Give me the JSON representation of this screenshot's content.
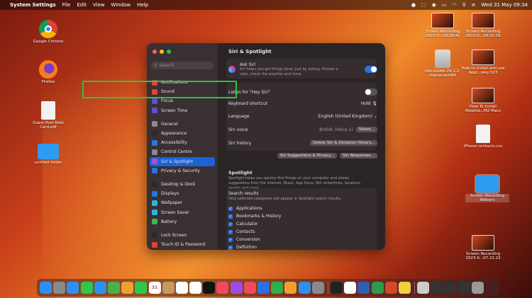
{
  "menubar": {
    "app_name": "System Settings",
    "items": [
      "File",
      "Edit",
      "View",
      "Window",
      "Help"
    ],
    "clock": "Wed 31 May  09:34"
  },
  "desktop_left": [
    {
      "label": "Google Chrome",
      "icon": "chrome-icon"
    },
    {
      "label": "Firefox",
      "icon": "firefox-icon"
    },
    {
      "label": "Guest Post Rate Card.pdf",
      "icon": "pdf-document-icon"
    },
    {
      "label": "untitled folder",
      "icon": "folder-icon"
    }
  ],
  "desktop_right": [
    {
      "label": "Screen Recording 2023-0...09.28.41"
    },
    {
      "label": "Screen Recording 2023-0...09.55.59"
    },
    {
      "label": "obs-studio-29.1.2-macos-arm64"
    },
    {
      "label": "How to install and use Appl...lexy 523"
    },
    {
      "label": "How To Install Rosetta...M2 Macs"
    },
    {
      "label": "iPhone contacts.csv"
    },
    {
      "label": "Screen Recording Webpro"
    },
    {
      "label": "Screen Recording 2023-0...07.22.23"
    }
  ],
  "window": {
    "title": "Siri & Spotlight",
    "search_placeholder": "Search",
    "sidebar": [
      {
        "label": "Notifications",
        "color": "#e0423a"
      },
      {
        "label": "Sound",
        "color": "#e0423a"
      },
      {
        "label": "Focus",
        "color": "#5a4fd6"
      },
      {
        "label": "Screen Time",
        "color": "#5a4fd6"
      },
      {
        "label": "General",
        "color": "#8a8a8e"
      },
      {
        "label": "Appearance",
        "color": "#2a2a2a"
      },
      {
        "label": "Accessibility",
        "color": "#1f7ae0"
      },
      {
        "label": "Control Centre",
        "color": "#8a8a8e"
      },
      {
        "label": "Siri & Spotlight",
        "color": "#b04ad8",
        "active": true
      },
      {
        "label": "Privacy & Security",
        "color": "#1f7ae0"
      },
      {
        "label": "Desktop & Dock",
        "color": "#2a2a2a"
      },
      {
        "label": "Displays",
        "color": "#1f7ae0"
      },
      {
        "label": "Wallpaper",
        "color": "#2fb4e0"
      },
      {
        "label": "Screen Saver",
        "color": "#2fb4e0"
      },
      {
        "label": "Battery",
        "color": "#2fbf4a"
      },
      {
        "label": "Lock Screen",
        "color": "#2a2a2a"
      },
      {
        "label": "Touch ID & Password",
        "color": "#e0423a"
      }
    ],
    "ask_siri": {
      "label": "Ask Siri",
      "description": "Siri helps you get things done, just by asking. Dictate a note, check the weather and more.",
      "enabled": true
    },
    "hey_siri": {
      "label": "Listen for \"Hey Siri\"",
      "enabled": false
    },
    "keyboard_shortcut": {
      "label": "Keyboard shortcut",
      "value": "Hold 🎙"
    },
    "language": {
      "label": "Language",
      "value": "English (United Kingdom) ⌄"
    },
    "siri_voice": {
      "label": "Siri voice",
      "value": "British (Voice 1)",
      "button": "Select..."
    },
    "siri_history": {
      "label": "Siri history",
      "button": "Delete Siri & Dictation History..."
    },
    "buttons": {
      "suggestions": "Siri Suggestions & Privacy...",
      "responses": "Siri Responses..."
    },
    "spotlight": {
      "title": "Spotlight",
      "description": "Spotlight helps you quickly find things on your computer and shows suggestions from the internet, Music, App Store, film showtimes, locations nearby and more."
    },
    "search_results": {
      "title": "Search results",
      "description": "Only selected categories will appear in Spotlight search results.",
      "items": [
        "Applications",
        "Bookmarks & History",
        "Calculator",
        "Contacts",
        "Conversion",
        "Definition"
      ]
    }
  },
  "dock": {
    "icons": [
      "finder-icon",
      "launchpad-icon",
      "safari-icon",
      "messages-icon",
      "mail-icon",
      "maps-icon",
      "photos-icon",
      "facetime-icon",
      "calendar-icon",
      "contacts-icon",
      "reminders-icon",
      "freeform-icon",
      "tv-icon",
      "music-icon",
      "podcasts-icon",
      "news-icon",
      "keynote-icon",
      "numbers-icon",
      "pages-icon",
      "app-store-icon",
      "system-settings-icon",
      "terminal-icon",
      "chrome-icon",
      "word-icon",
      "excel-icon",
      "powerpoint-icon",
      "notes-icon",
      "recording-icon",
      "window-icon",
      "window-icon",
      "window-icon",
      "trash-icon"
    ],
    "colors": [
      "#2f8ff0",
      "#8a8a8a",
      "#2f8ff0",
      "#2fc84a",
      "#2f8ff0",
      "#4ab04a",
      "#f0a030",
      "#2fc84a",
      "#ffffff",
      "#c89860",
      "#ffffff",
      "#ffffff",
      "#111111",
      "#f04a5a",
      "#a04ae0",
      "#f04a5a",
      "#2f6fe0",
      "#2fb04a",
      "#f0a030",
      "#2f8ff0",
      "#8a8a8e",
      "#222222",
      "#ffffff",
      "#2f5fb0",
      "#2f9a4a",
      "#d04a2a",
      "#f0d040",
      "#cccccc",
      "#333333",
      "#333333",
      "#333333",
      "#9a9a9a"
    ],
    "calendar_day": "31"
  }
}
